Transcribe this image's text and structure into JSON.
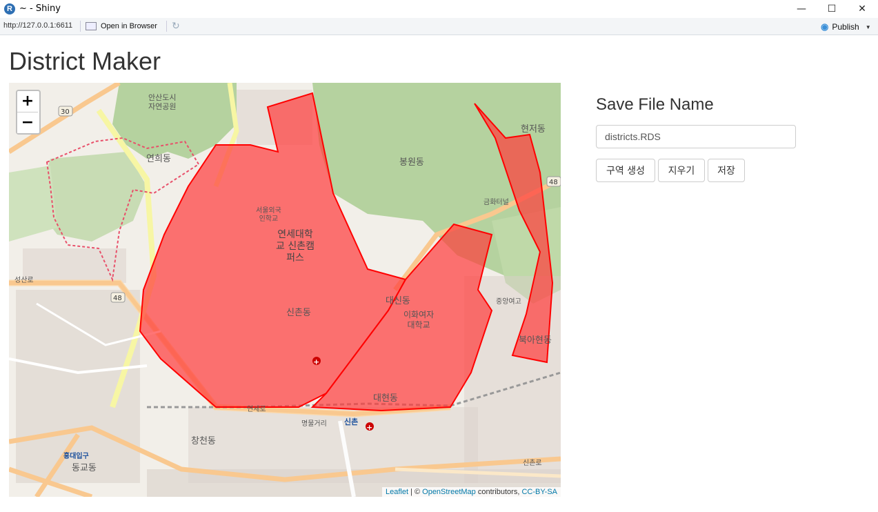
{
  "window": {
    "title": "~ - Shiny",
    "minimize": "—",
    "maximize": "☐",
    "close": "✕"
  },
  "toolbar": {
    "url": "http://127.0.0.1:6611",
    "open_in_browser": "Open in Browser",
    "publish": "Publish"
  },
  "page": {
    "title": "District Maker"
  },
  "map": {
    "zoom_in": "+",
    "zoom_out": "−",
    "attribution": {
      "leaflet": "Leaflet",
      "sep": " | © ",
      "osm": "OpenStreetMap",
      "contributors": " contributors, ",
      "license": "CC-BY-SA"
    },
    "labels": {
      "yonsei": "연세대학\n교 신촌캠\n퍼스",
      "sinchon_dong": "신촌동",
      "daesin_dong": "대신동",
      "ewha": "이화여자\n대학교",
      "daehyeon_dong": "대현동",
      "bongwon_dong": "봉원동",
      "hyeonjeo_dong": "현저동",
      "yeonhui_dong": "연희동",
      "changcheon_dong": "창천동",
      "hongdae_ipgu": "홍대입구",
      "donggyo_dong": "동교동",
      "bugahyeon_dong": "북아현동",
      "sinchon": "신촌",
      "ahn_san": "안산도시\n자연공원",
      "seoul_foreign": "서울외국\n인학교",
      "jungang_hs": "중앙여고",
      "myeongmul": "명물거리",
      "seongsan_ro": "성산로",
      "geumhwa_tunnel": "금화터널",
      "sinchon_ro": "신촌로",
      "yeonse_ro": "연세로"
    }
  },
  "sidebar": {
    "heading": "Save File Name",
    "filename_value": "districts.RDS",
    "buttons": {
      "create": "구역 생성",
      "clear": "지우기",
      "save": "저장"
    }
  },
  "colors": {
    "polygon_fill": "#ff3b3b",
    "polygon_stroke": "#ff0000",
    "park": "#b5d29f",
    "road_major": "#f9c88f",
    "road_yellow": "#f7f6a4",
    "building": "#d9d0c9",
    "link": "#0078a8"
  }
}
